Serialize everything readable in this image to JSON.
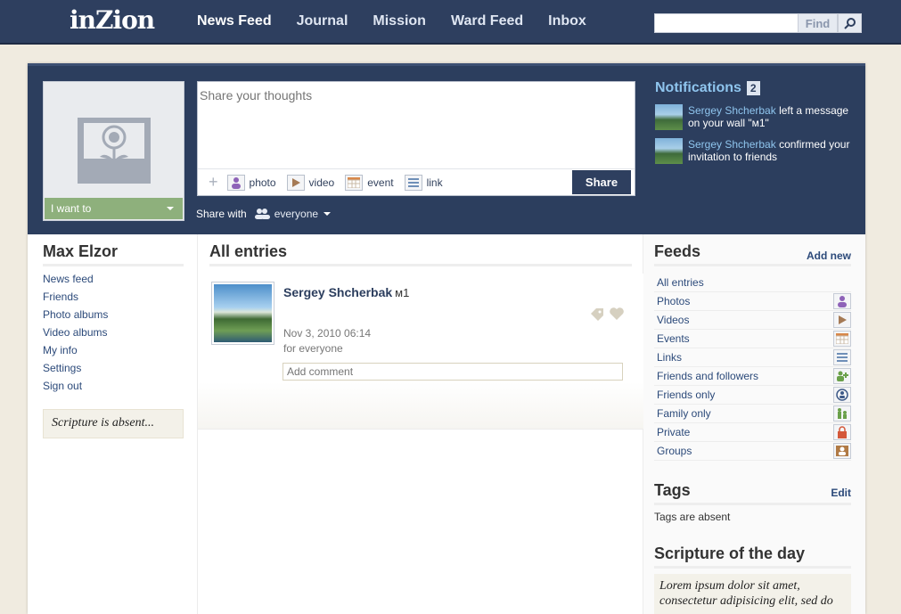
{
  "brand": {
    "logo": "inZion"
  },
  "nav": {
    "items": [
      {
        "label": "News Feed"
      },
      {
        "label": "Journal"
      },
      {
        "label": "Mission"
      },
      {
        "label": "Ward Feed"
      },
      {
        "label": "Inbox"
      }
    ]
  },
  "search": {
    "value": "",
    "button_label": "Find"
  },
  "profile": {
    "i_want_label": "I want to"
  },
  "share": {
    "placeholder": "Share your thoughts",
    "tools": [
      {
        "label": "photo",
        "icon": "person-photo-icon"
      },
      {
        "label": "video",
        "icon": "play-icon"
      },
      {
        "label": "event",
        "icon": "calendar-icon"
      },
      {
        "label": "link",
        "icon": "lines-icon"
      }
    ],
    "button_label": "Share",
    "share_with_label": "Share with",
    "share_with_value": "everyone"
  },
  "notifications": {
    "title": "Notifications",
    "count": "2",
    "items": [
      {
        "who": "Sergey Shcherbak",
        "text": " left a message on your wall \"м1\""
      },
      {
        "who": "Sergey Shcherbak",
        "text": " confirmed your invitation to friends"
      }
    ]
  },
  "left": {
    "name": "Max Elzor",
    "links": [
      "News feed",
      "Friends",
      "Photo albums",
      "Video albums",
      "My info",
      "Settings",
      "Sign out"
    ],
    "scripture": "Scripture is absent..."
  },
  "center": {
    "title": "All entries",
    "entry": {
      "author": "Sergey Shcherbak",
      "subtitle": "м1",
      "date": "Nov 3, 2010 06:14",
      "visibility": "for everyone",
      "comment_placeholder": "Add comment"
    }
  },
  "right": {
    "feeds_title": "Feeds",
    "add_new": "Add new",
    "feeds": [
      {
        "label": "All entries",
        "icon": ""
      },
      {
        "label": "Photos",
        "icon": "person-photo-icon"
      },
      {
        "label": "Videos",
        "icon": "play-icon"
      },
      {
        "label": "Events",
        "icon": "calendar-icon"
      },
      {
        "label": "Links",
        "icon": "lines-icon"
      },
      {
        "label": "Friends and followers",
        "icon": "add-friend-icon"
      },
      {
        "label": "Friends only",
        "icon": "friend-circle-icon"
      },
      {
        "label": "Family only",
        "icon": "family-icon"
      },
      {
        "label": "Private",
        "icon": "lock-icon"
      },
      {
        "label": "Groups",
        "icon": "group-icon"
      }
    ],
    "tags_title": "Tags",
    "edit": "Edit",
    "tags_absent": "Tags are absent",
    "sod_title": "Scripture of the day",
    "sod_text": "Lorem ipsum dolor sit amet, consectetur adipisicing elit, sed do"
  },
  "colors": {
    "topbar": "#2e3f5f",
    "header_band": "#2c3e5e",
    "accent_link": "#2c4a7a",
    "notif_title": "#8fc5ee",
    "i_want": "#8eb07c"
  }
}
